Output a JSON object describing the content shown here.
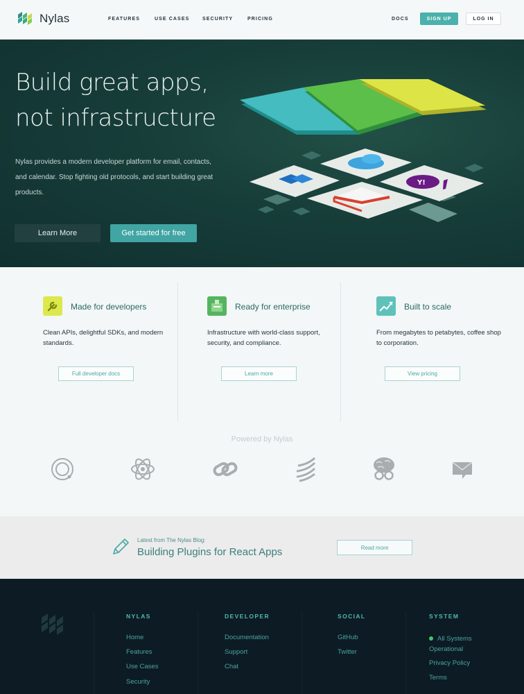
{
  "nav": {
    "logo": "Nylas",
    "links": [
      "FEATURES",
      "USE CASES",
      "SECURITY",
      "PRICING"
    ],
    "docs": "DOCS",
    "signup": "SIGN UP",
    "login": "LOG IN"
  },
  "hero": {
    "title_line1": "Build great apps,",
    "title_line2": "not infrastructure",
    "description": "Nylas provides a modern developer platform for email, contacts, and calendar. Stop fighting old protocols, and start building great products.",
    "learn_more": "Learn More",
    "get_started": "Get started for free"
  },
  "features": [
    {
      "title": "Made for developers",
      "desc": "Clean APIs, delightful SDKs, and modern standards.",
      "button": "Full developer docs",
      "icon": "wrench-icon"
    },
    {
      "title": "Ready for enterprise",
      "desc": "Infrastructure with world-class support, security, and compliance.",
      "button": "Learn more",
      "icon": "enterprise-icon"
    },
    {
      "title": "Built to scale",
      "desc": "From megabytes to petabytes, coffee shop to corporation.",
      "button": "View pricing",
      "icon": "growth-chart-icon"
    }
  ],
  "powered": {
    "label": "Powered by Nylas",
    "icons": [
      "orbit-logo-icon",
      "atom-logo-icon",
      "link-logo-icon",
      "stripes-logo-icon",
      "brain-glasses-logo-icon",
      "envelope-logo-icon"
    ]
  },
  "blog": {
    "kicker": "Latest from The Nylas Blog:",
    "title": "Building Plugins for React Apps",
    "button": "Read more"
  },
  "footer": {
    "columns": [
      {
        "heading": "NYLAS",
        "links": [
          "Home",
          "Features",
          "Use Cases",
          "Security"
        ]
      },
      {
        "heading": "DEVELOPER",
        "links": [
          "Documentation",
          "Support",
          "Chat"
        ]
      },
      {
        "heading": "SOCIAL",
        "links": [
          "GitHub",
          "Twitter"
        ]
      },
      {
        "heading": "SYSTEM",
        "status": "All Systems Operational",
        "links": [
          "Privacy Policy",
          "Terms"
        ]
      }
    ]
  },
  "colors": {
    "accent": "#4bb1ac",
    "hero_bg": "#173d39",
    "footer_bg": "#0d1b24",
    "status_ok": "#43c472"
  }
}
